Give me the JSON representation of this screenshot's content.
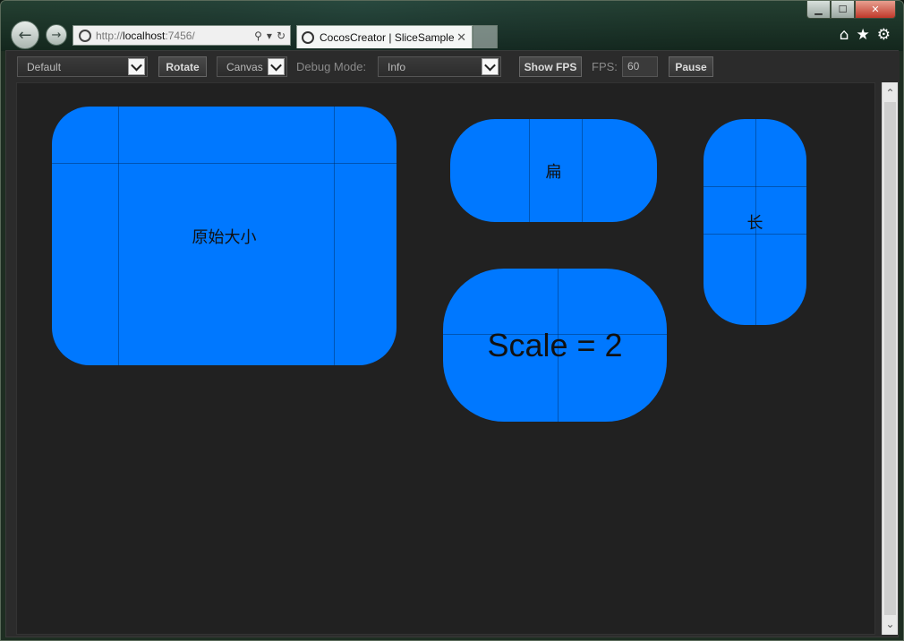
{
  "browser": {
    "address": {
      "scheme": "http://",
      "host": "localhost",
      "port_path": ":7456/"
    },
    "tab_title": "CocosCreator | SliceSample",
    "tab_close": "✕",
    "caption": {
      "minimize": "▁",
      "maximize": "☐",
      "close": "✕"
    },
    "icons": [
      "back-arrow-icon",
      "forward-arrow-icon",
      "search-icon",
      "refresh-icon",
      "home-icon",
      "favorites-star-icon",
      "settings-gear-icon"
    ]
  },
  "toolbar": {
    "device_select": "Default",
    "rotate_label": "Rotate",
    "canvas_select": "Canvas",
    "debug_mode_label": "Debug Mode:",
    "debug_mode_select": "Info",
    "show_fps_label": "Show FPS",
    "fps_label": "FPS:",
    "fps_value": "60",
    "pause_label": "Pause"
  },
  "scene": {
    "background": "#212121",
    "slice_color": "#0078ff",
    "sprites": [
      {
        "id": "original",
        "label": "原始大小"
      },
      {
        "id": "flat",
        "label": "扁"
      },
      {
        "id": "tall",
        "label": "长"
      },
      {
        "id": "scaled",
        "label": "Scale = 2"
      }
    ]
  }
}
